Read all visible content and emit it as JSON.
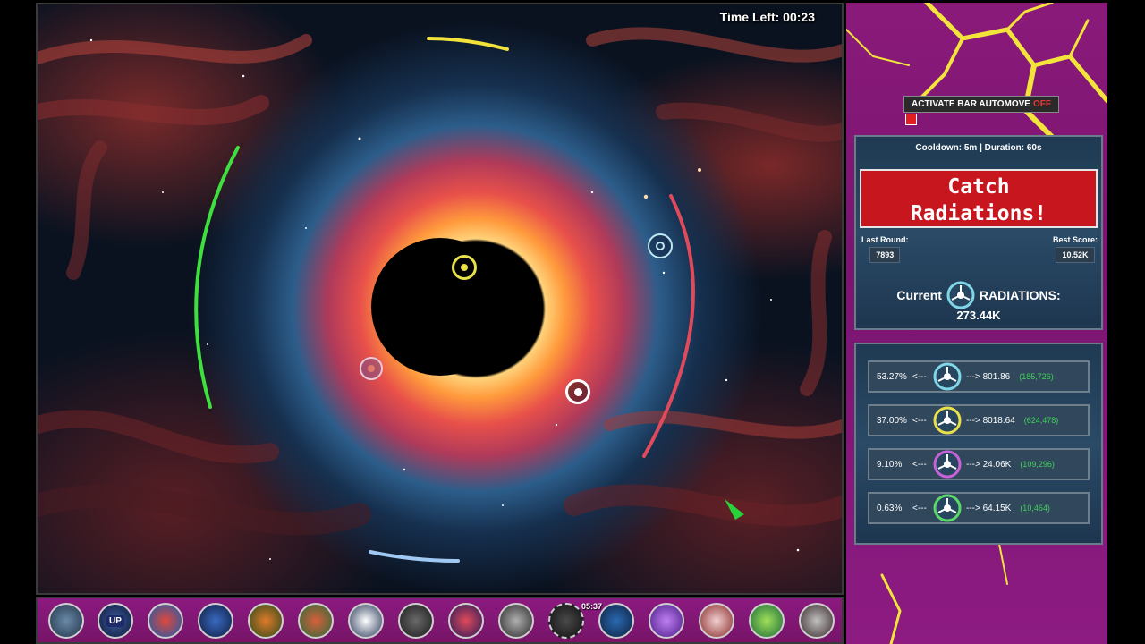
{
  "game": {
    "timer": "Time Left: 00:23"
  },
  "panel": {
    "automove_label": "ACTIVATE BAR AUTOMOVE",
    "automove_state": "OFF",
    "cooldown": "Cooldown: 5m | Duration: 60s",
    "banner_line1": "Catch",
    "banner_line2": "Radiations!",
    "last_round_label": "Last Round:",
    "last_round_value": "7893",
    "best_score_label": "Best Score:",
    "best_score_value": "10.52K",
    "current_label": "Current",
    "radiations_label": "RADIATIONS:",
    "current_value": "273.44K",
    "rates": [
      {
        "pct": "53.27%",
        "arrow_left": "<---",
        "arrow_right": "---> 801.86",
        "count": "(185,726)",
        "color": "#7fd6e6"
      },
      {
        "pct": "37.00%",
        "arrow_left": "<---",
        "arrow_right": "---> 8018.64",
        "count": "(624,478)",
        "color": "#e8e04a"
      },
      {
        "pct": "9.10%",
        "arrow_left": "<---",
        "arrow_right": "---> 24.06K",
        "count": "(109,296)",
        "color": "#c862d8"
      },
      {
        "pct": "0.63%",
        "arrow_left": "<---",
        "arrow_right": "---> 64.15K",
        "count": "(10,464)",
        "color": "#5ad86a"
      }
    ]
  },
  "bottombar": {
    "level_up_label": "UP",
    "slot_timer": "05:37",
    "icons": [
      "rocket-icon",
      "level-up-icon",
      "gem-orb-icon",
      "cube-icon",
      "helmet-icon",
      "alien-icon",
      "starburst-icon",
      "padlock-icon",
      "galaxy-icon",
      "ufo-icon",
      "asteroid-icon",
      "portal-icon",
      "radiation-icon",
      "explosion-icon",
      "vortex-icon",
      "atom-icon"
    ]
  },
  "colors": {
    "panel_bg": "#8a1a7a",
    "banner_red": "#c8161e",
    "box_blue": "#1f3a52",
    "paddle_green": "#3ee03e",
    "paddle_red": "#e04a5a",
    "paddle_yellow": "#f2e23a",
    "paddle_blue": "#9fc8f2"
  }
}
